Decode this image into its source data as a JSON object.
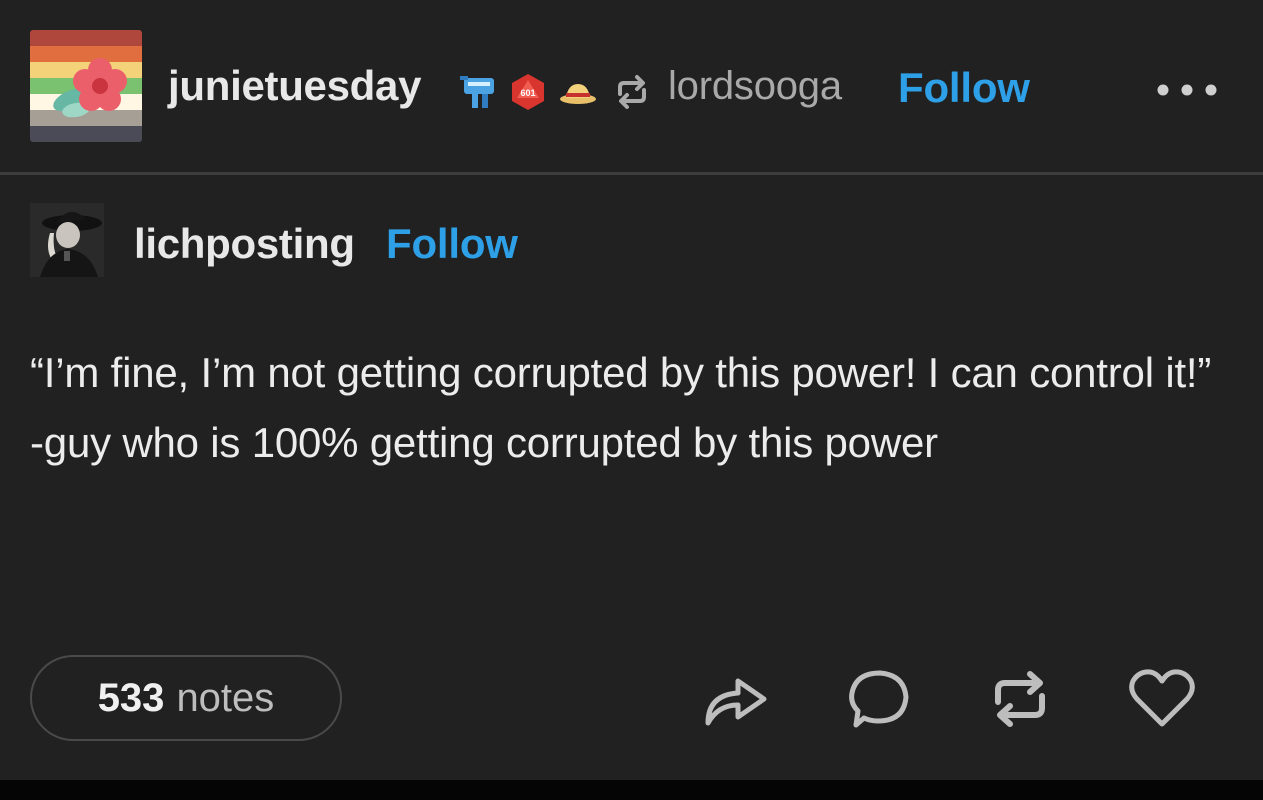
{
  "header": {
    "blog_name": "junietuesday",
    "badges": [
      "cyber-dog-badge-icon",
      "d20-badge-icon",
      "straw-hat-badge-icon"
    ],
    "d20_label": "601",
    "reblog_icon": "reblog-icon",
    "reblogged_from": "lordsooga",
    "follow_label": "Follow",
    "more_icon": "more-icon"
  },
  "source": {
    "blog_name": "lichposting",
    "follow_label": "Follow"
  },
  "post": {
    "text": "“I’m fine, I’m not getting corrupted by this power! I can control it!” -guy who is 100% getting corrupted by this power"
  },
  "footer": {
    "notes_count": "533",
    "notes_label": "notes",
    "actions": [
      "share-icon",
      "reply-icon",
      "reblog-icon",
      "like-icon"
    ]
  },
  "colors": {
    "background": "#212121",
    "link_blue": "#2ea0e8",
    "text": "#ececec",
    "muted": "#a9a9a9",
    "divider": "#3d3d3d"
  }
}
